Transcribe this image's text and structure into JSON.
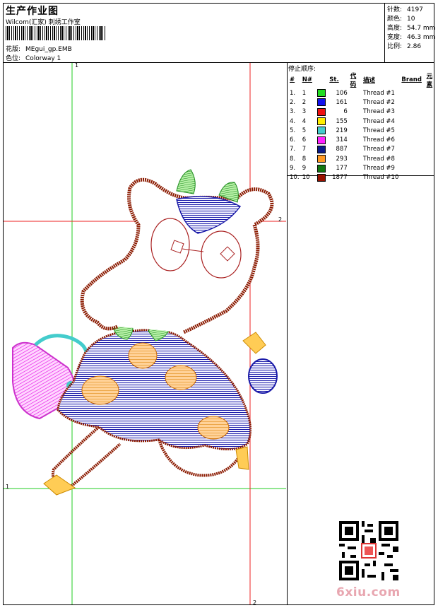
{
  "header": {
    "title": "生产作业图",
    "subtitle": "Wilcom(汇家) 刺绣工作室",
    "design_label": "花版:",
    "design_value": "MEgui_gp.EMB",
    "colorway_label": "色位:",
    "colorway_value": "Colorway 1"
  },
  "stats": [
    {
      "label": "针数:",
      "value": "4197"
    },
    {
      "label": "颜色:",
      "value": "10"
    },
    {
      "label": "高度:",
      "value": "54.7 mm"
    },
    {
      "label": "宽度:",
      "value": "46.3 mm"
    },
    {
      "label": "比例:",
      "value": "2.86"
    }
  ],
  "threads": {
    "heading": "停止顺序:",
    "columns": [
      "#",
      "N#",
      "St.",
      "代码",
      "描述",
      "Brand",
      "元素"
    ],
    "rows": [
      {
        "n": "1.",
        "nn": "1",
        "color": "#22dd22",
        "st": "106",
        "desc": "Thread #1"
      },
      {
        "n": "2.",
        "nn": "2",
        "color": "#1111ee",
        "st": "161",
        "desc": "Thread #2"
      },
      {
        "n": "3.",
        "nn": "3",
        "color": "#ee1111",
        "st": "6",
        "desc": "Thread #3"
      },
      {
        "n": "4.",
        "nn": "4",
        "color": "#ffee00",
        "st": "155",
        "desc": "Thread #4"
      },
      {
        "n": "5.",
        "nn": "5",
        "color": "#44cccc",
        "st": "219",
        "desc": "Thread #5"
      },
      {
        "n": "6.",
        "nn": "6",
        "color": "#ff22ff",
        "st": "314",
        "desc": "Thread #6"
      },
      {
        "n": "7.",
        "nn": "7",
        "color": "#0a1a88",
        "st": "887",
        "desc": "Thread #7"
      },
      {
        "n": "8.",
        "nn": "8",
        "color": "#ff9922",
        "st": "293",
        "desc": "Thread #8"
      },
      {
        "n": "9.",
        "nn": "9",
        "color": "#117711",
        "st": "177",
        "desc": "Thread #9"
      },
      {
        "n": "10.",
        "nn": "10",
        "color": "#991100",
        "st": "1877",
        "desc": "Thread #10"
      }
    ]
  },
  "axes": {
    "v1": "1",
    "h2": "2",
    "h1": "1",
    "v2": "2"
  },
  "watermark": "6xiu.com",
  "colors": {
    "guide_green": "#22cc22",
    "guide_red": "#ee2222",
    "outline_brown": "#8b1a00"
  }
}
